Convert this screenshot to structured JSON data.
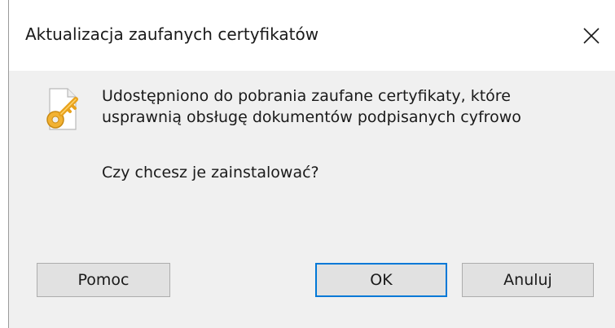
{
  "window": {
    "title": "Aktualizacja zaufanych certyfikatów"
  },
  "content": {
    "icon": "certificate-key-icon",
    "message_line1": "Udostępniono do pobrania zaufane certyfikaty, które",
    "message_line2": "usprawnią obsługę dokumentów podpisanych cyfrowo",
    "question": "Czy chcesz je zainstalować?"
  },
  "buttons": {
    "help_label": "Pomoc",
    "ok_label": "OK",
    "cancel_label": "Anuluj"
  },
  "colors": {
    "accent": "#0078d7",
    "dialog_background": "#f0f0f0",
    "button_background": "#e1e1e1"
  }
}
